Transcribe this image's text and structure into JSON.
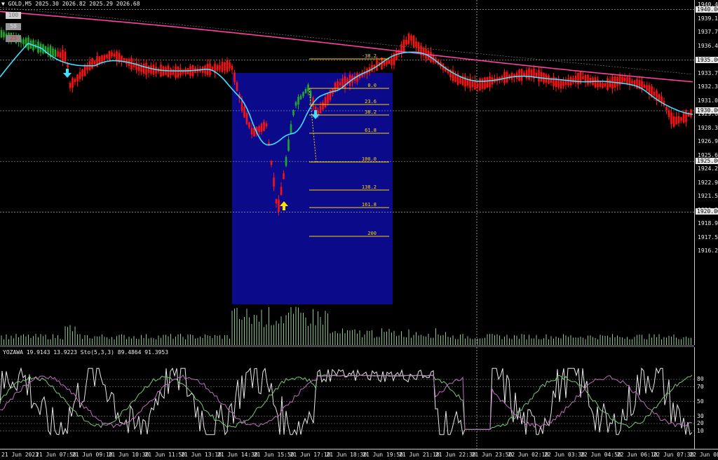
{
  "header": {
    "symbol_label": "GOLD,M5",
    "ohlc": "2025.30 2026.82 2025.29 2026.68"
  },
  "panel_buttons": [
    {
      "label": "100",
      "color": "#d0d0d0",
      "text": "#7a7a7a"
    },
    {
      "label": "50",
      "color": "#9a9a9a",
      "text": "#d8d8d8"
    },
    {
      "label": "25",
      "color": "#8a8a8a",
      "text": "#ff3030"
    }
  ],
  "price_axis": {
    "ticks": [
      "1940.45",
      "1939.10",
      "1937.75",
      "1936.40",
      "1935.05",
      "1933.70",
      "1932.35",
      "1931.00",
      "1929.65",
      "1928.30",
      "1926.95",
      "1925.60",
      "1924.25",
      "1922.90",
      "1921.55",
      "1920.20",
      "1918.90",
      "1917.55",
      "1916.20"
    ],
    "levels": [
      "1940.00",
      "1935.00",
      "1930.00",
      "1925.00",
      "1920.00"
    ]
  },
  "fibo": {
    "levels": [
      "-38.2",
      "0.0",
      "23.6",
      "38.2",
      "61.8",
      "100.0",
      "138.2",
      "161.8",
      "200"
    ]
  },
  "sub": {
    "label": "YOZAWA 19.9143 13.9223 Sto(5,3,3) 89.4864 91.3953",
    "levels": [
      "80",
      "70",
      "50",
      "30",
      "20",
      "10"
    ]
  },
  "time_axis": {
    "ticks": [
      "21 Jun 2023",
      "21 Jun 07:50",
      "21 Jun 09:10",
      "21 Jun 10:30",
      "21 Jun 11:50",
      "21 Jun 13:10",
      "21 Jun 14:30",
      "21 Jun 15:50",
      "21 Jun 17:10",
      "21 Jun 18:30",
      "21 Jun 19:50",
      "21 Jun 21:10",
      "21 Jun 22:30",
      "21 Jun 23:50",
      "22 Jun 02:10",
      "22 Jun 03:30",
      "22 Jun 04:50",
      "22 Jun 06:10",
      "22 Jun 07:30",
      "22 Jun 08:50"
    ]
  },
  "colors": {
    "bull": "#22a82a",
    "bear": "#ff1010",
    "ma_fast": "#40e0ff",
    "ma_slow": "#ff40a0",
    "fibo": "#ffd700",
    "rect": "#0a0a8a",
    "grid": "#9a9a9a",
    "volume": "#90c890"
  },
  "arrow_icons": [
    "up-arrow-icon",
    "down-arrow-icon"
  ]
}
